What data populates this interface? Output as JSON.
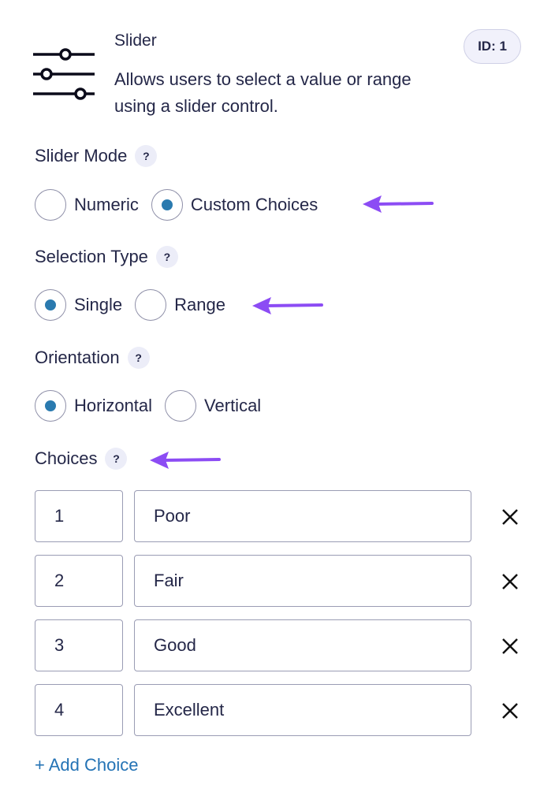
{
  "field": {
    "icon": "slider-icon",
    "title": "Slider",
    "description": "Allows users to select a value or range using a slider control.",
    "id_badge": "ID: 1"
  },
  "slider_mode": {
    "label": "Slider Mode",
    "help": "?",
    "options": [
      "Numeric",
      "Custom Choices"
    ],
    "selected": "Custom Choices"
  },
  "selection_type": {
    "label": "Selection Type",
    "help": "?",
    "options": [
      "Single",
      "Range"
    ],
    "selected": "Single"
  },
  "orientation": {
    "label": "Orientation",
    "help": "?",
    "options": [
      "Horizontal",
      "Vertical"
    ],
    "selected": "Horizontal"
  },
  "choices": {
    "label": "Choices",
    "help": "?",
    "rows": [
      {
        "value": "1",
        "text": "Poor"
      },
      {
        "value": "2",
        "text": "Fair"
      },
      {
        "value": "3",
        "text": "Good"
      },
      {
        "value": "4",
        "text": "Excellent"
      }
    ],
    "add_label": "+ Add Choice"
  },
  "colors": {
    "text": "#242748",
    "radio_selected": "#2a7aaf",
    "link": "#2473b5",
    "annotation_arrow": "#8c4cf4"
  }
}
